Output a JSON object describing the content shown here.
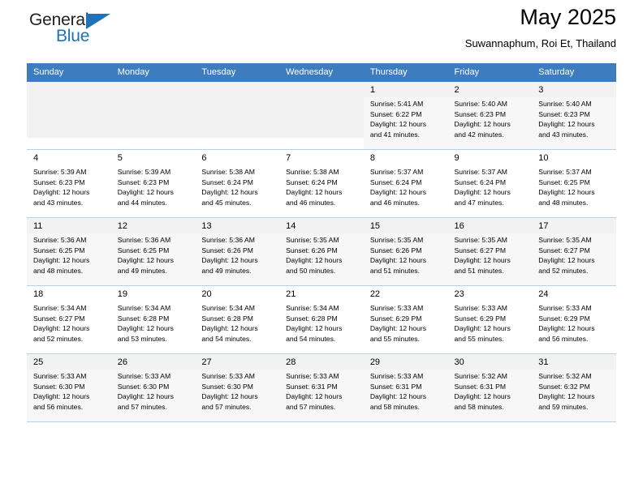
{
  "brand": {
    "name_top": "General",
    "name_bottom": "Blue",
    "triangle_icon": "triangle-icon",
    "accent_color": "#1f72b8"
  },
  "header": {
    "title": "May 2025",
    "subtitle": "Suwannaphum, Roi Et, Thailand"
  },
  "calendar": {
    "header_bg": "#3d7dbf",
    "weekdays": [
      "Sunday",
      "Monday",
      "Tuesday",
      "Wednesday",
      "Thursday",
      "Friday",
      "Saturday"
    ],
    "labels": {
      "sunrise": "Sunrise:",
      "sunset": "Sunset:",
      "daylight": "Daylight:"
    },
    "weeks": [
      [
        {
          "day": "",
          "sunrise": "",
          "sunset": "",
          "daylight1": "",
          "daylight2": "",
          "blank": true
        },
        {
          "day": "",
          "sunrise": "",
          "sunset": "",
          "daylight1": "",
          "daylight2": "",
          "blank": true
        },
        {
          "day": "",
          "sunrise": "",
          "sunset": "",
          "daylight1": "",
          "daylight2": "",
          "blank": true
        },
        {
          "day": "",
          "sunrise": "",
          "sunset": "",
          "daylight1": "",
          "daylight2": "",
          "blank": true
        },
        {
          "day": "1",
          "sunrise": "Sunrise: 5:41 AM",
          "sunset": "Sunset: 6:22 PM",
          "daylight1": "Daylight: 12 hours",
          "daylight2": "and 41 minutes."
        },
        {
          "day": "2",
          "sunrise": "Sunrise: 5:40 AM",
          "sunset": "Sunset: 6:23 PM",
          "daylight1": "Daylight: 12 hours",
          "daylight2": "and 42 minutes."
        },
        {
          "day": "3",
          "sunrise": "Sunrise: 5:40 AM",
          "sunset": "Sunset: 6:23 PM",
          "daylight1": "Daylight: 12 hours",
          "daylight2": "and 43 minutes."
        }
      ],
      [
        {
          "day": "4",
          "sunrise": "Sunrise: 5:39 AM",
          "sunset": "Sunset: 6:23 PM",
          "daylight1": "Daylight: 12 hours",
          "daylight2": "and 43 minutes."
        },
        {
          "day": "5",
          "sunrise": "Sunrise: 5:39 AM",
          "sunset": "Sunset: 6:23 PM",
          "daylight1": "Daylight: 12 hours",
          "daylight2": "and 44 minutes."
        },
        {
          "day": "6",
          "sunrise": "Sunrise: 5:38 AM",
          "sunset": "Sunset: 6:24 PM",
          "daylight1": "Daylight: 12 hours",
          "daylight2": "and 45 minutes."
        },
        {
          "day": "7",
          "sunrise": "Sunrise: 5:38 AM",
          "sunset": "Sunset: 6:24 PM",
          "daylight1": "Daylight: 12 hours",
          "daylight2": "and 46 minutes."
        },
        {
          "day": "8",
          "sunrise": "Sunrise: 5:37 AM",
          "sunset": "Sunset: 6:24 PM",
          "daylight1": "Daylight: 12 hours",
          "daylight2": "and 46 minutes."
        },
        {
          "day": "9",
          "sunrise": "Sunrise: 5:37 AM",
          "sunset": "Sunset: 6:24 PM",
          "daylight1": "Daylight: 12 hours",
          "daylight2": "and 47 minutes."
        },
        {
          "day": "10",
          "sunrise": "Sunrise: 5:37 AM",
          "sunset": "Sunset: 6:25 PM",
          "daylight1": "Daylight: 12 hours",
          "daylight2": "and 48 minutes."
        }
      ],
      [
        {
          "day": "11",
          "sunrise": "Sunrise: 5:36 AM",
          "sunset": "Sunset: 6:25 PM",
          "daylight1": "Daylight: 12 hours",
          "daylight2": "and 48 minutes."
        },
        {
          "day": "12",
          "sunrise": "Sunrise: 5:36 AM",
          "sunset": "Sunset: 6:25 PM",
          "daylight1": "Daylight: 12 hours",
          "daylight2": "and 49 minutes."
        },
        {
          "day": "13",
          "sunrise": "Sunrise: 5:36 AM",
          "sunset": "Sunset: 6:26 PM",
          "daylight1": "Daylight: 12 hours",
          "daylight2": "and 49 minutes."
        },
        {
          "day": "14",
          "sunrise": "Sunrise: 5:35 AM",
          "sunset": "Sunset: 6:26 PM",
          "daylight1": "Daylight: 12 hours",
          "daylight2": "and 50 minutes."
        },
        {
          "day": "15",
          "sunrise": "Sunrise: 5:35 AM",
          "sunset": "Sunset: 6:26 PM",
          "daylight1": "Daylight: 12 hours",
          "daylight2": "and 51 minutes."
        },
        {
          "day": "16",
          "sunrise": "Sunrise: 5:35 AM",
          "sunset": "Sunset: 6:27 PM",
          "daylight1": "Daylight: 12 hours",
          "daylight2": "and 51 minutes."
        },
        {
          "day": "17",
          "sunrise": "Sunrise: 5:35 AM",
          "sunset": "Sunset: 6:27 PM",
          "daylight1": "Daylight: 12 hours",
          "daylight2": "and 52 minutes."
        }
      ],
      [
        {
          "day": "18",
          "sunrise": "Sunrise: 5:34 AM",
          "sunset": "Sunset: 6:27 PM",
          "daylight1": "Daylight: 12 hours",
          "daylight2": "and 52 minutes."
        },
        {
          "day": "19",
          "sunrise": "Sunrise: 5:34 AM",
          "sunset": "Sunset: 6:28 PM",
          "daylight1": "Daylight: 12 hours",
          "daylight2": "and 53 minutes."
        },
        {
          "day": "20",
          "sunrise": "Sunrise: 5:34 AM",
          "sunset": "Sunset: 6:28 PM",
          "daylight1": "Daylight: 12 hours",
          "daylight2": "and 54 minutes."
        },
        {
          "day": "21",
          "sunrise": "Sunrise: 5:34 AM",
          "sunset": "Sunset: 6:28 PM",
          "daylight1": "Daylight: 12 hours",
          "daylight2": "and 54 minutes."
        },
        {
          "day": "22",
          "sunrise": "Sunrise: 5:33 AM",
          "sunset": "Sunset: 6:29 PM",
          "daylight1": "Daylight: 12 hours",
          "daylight2": "and 55 minutes."
        },
        {
          "day": "23",
          "sunrise": "Sunrise: 5:33 AM",
          "sunset": "Sunset: 6:29 PM",
          "daylight1": "Daylight: 12 hours",
          "daylight2": "and 55 minutes."
        },
        {
          "day": "24",
          "sunrise": "Sunrise: 5:33 AM",
          "sunset": "Sunset: 6:29 PM",
          "daylight1": "Daylight: 12 hours",
          "daylight2": "and 56 minutes."
        }
      ],
      [
        {
          "day": "25",
          "sunrise": "Sunrise: 5:33 AM",
          "sunset": "Sunset: 6:30 PM",
          "daylight1": "Daylight: 12 hours",
          "daylight2": "and 56 minutes."
        },
        {
          "day": "26",
          "sunrise": "Sunrise: 5:33 AM",
          "sunset": "Sunset: 6:30 PM",
          "daylight1": "Daylight: 12 hours",
          "daylight2": "and 57 minutes."
        },
        {
          "day": "27",
          "sunrise": "Sunrise: 5:33 AM",
          "sunset": "Sunset: 6:30 PM",
          "daylight1": "Daylight: 12 hours",
          "daylight2": "and 57 minutes."
        },
        {
          "day": "28",
          "sunrise": "Sunrise: 5:33 AM",
          "sunset": "Sunset: 6:31 PM",
          "daylight1": "Daylight: 12 hours",
          "daylight2": "and 57 minutes."
        },
        {
          "day": "29",
          "sunrise": "Sunrise: 5:33 AM",
          "sunset": "Sunset: 6:31 PM",
          "daylight1": "Daylight: 12 hours",
          "daylight2": "and 58 minutes."
        },
        {
          "day": "30",
          "sunrise": "Sunrise: 5:32 AM",
          "sunset": "Sunset: 6:31 PM",
          "daylight1": "Daylight: 12 hours",
          "daylight2": "and 58 minutes."
        },
        {
          "day": "31",
          "sunrise": "Sunrise: 5:32 AM",
          "sunset": "Sunset: 6:32 PM",
          "daylight1": "Daylight: 12 hours",
          "daylight2": "and 59 minutes."
        }
      ]
    ]
  }
}
